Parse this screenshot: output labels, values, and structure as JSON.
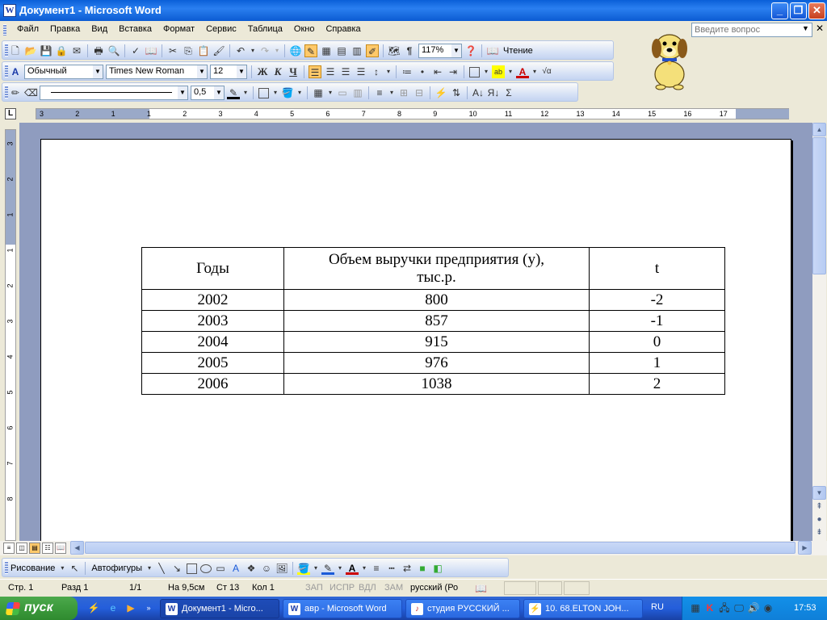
{
  "window": {
    "title": "Документ1 - Microsoft Word"
  },
  "menu": {
    "items": [
      "Файл",
      "Правка",
      "Вид",
      "Вставка",
      "Формат",
      "Сервис",
      "Таблица",
      "Окно",
      "Справка"
    ],
    "help_placeholder": "Введите вопрос"
  },
  "standard_toolbar": {
    "zoom": "117%",
    "reading_label": "Чтение"
  },
  "formatting_toolbar": {
    "style": "Обычный",
    "font": "Times New Roman",
    "size": "12"
  },
  "tables_toolbar": {
    "line_weight": "0,5"
  },
  "document": {
    "table": {
      "headers": [
        "Годы",
        "Объем выручки предприятия (у), тыс.р.",
        "t"
      ],
      "rows": [
        [
          "2002",
          "800",
          "-2"
        ],
        [
          "2003",
          "857",
          "-1"
        ],
        [
          "2004",
          "915",
          "0"
        ],
        [
          "2005",
          "976",
          "1"
        ],
        [
          "2006",
          "1038",
          "2"
        ]
      ]
    }
  },
  "drawing_toolbar": {
    "draw_label": "Рисование",
    "autoshapes_label": "Автофигуры"
  },
  "status": {
    "page": "Стр. 1",
    "section": "Разд 1",
    "pages": "1/1",
    "at": "На 9,5см",
    "line": "Ст 13",
    "col": "Кол 1",
    "rec": "ЗАП",
    "trk": "ИСПР",
    "ext": "ВДЛ",
    "ovr": "ЗАМ",
    "language": "русский (Ро"
  },
  "taskbar": {
    "start_label": "пуск",
    "tasks": [
      "Документ1 - Micro...",
      "авр - Microsoft Word",
      "студия РУССКИЙ ...",
      "10. 68.ELTON JOH..."
    ],
    "lang": "RU",
    "clock": "17:53"
  },
  "ruler_numbers": [
    "3",
    "2",
    "1",
    "1",
    "2",
    "3",
    "4",
    "5",
    "6",
    "7",
    "8",
    "9",
    "10",
    "11",
    "12",
    "13",
    "14",
    "15",
    "16",
    "17"
  ],
  "vruler_numbers": [
    "3",
    "2",
    "1",
    "1",
    "2",
    "3",
    "4",
    "5",
    "6",
    "7",
    "8"
  ]
}
